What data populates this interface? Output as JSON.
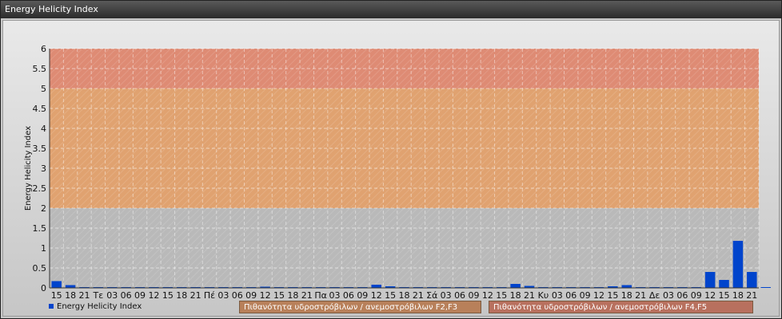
{
  "window": {
    "title": "Energy Helicity Index"
  },
  "chart_data": {
    "type": "bar",
    "title": "",
    "xlabel": "",
    "ylabel": "Energy Helicity Index",
    "ylim": [
      0,
      6
    ],
    "yticks": [
      "0",
      "0.5",
      "1",
      "1.5",
      "2",
      "2.5",
      "3",
      "3.5",
      "4",
      "4.5",
      "5",
      "5.5",
      "6"
    ],
    "grid": true,
    "legend_placement": "bottom",
    "categories": [
      "15",
      "18",
      "21",
      "Τε",
      "03",
      "06",
      "09",
      "12",
      "15",
      "18",
      "21",
      "Πέ",
      "03",
      "06",
      "09",
      "12",
      "15",
      "18",
      "21",
      "Πα",
      "03",
      "06",
      "09",
      "12",
      "15",
      "18",
      "21",
      "Σά",
      "03",
      "06",
      "09",
      "12",
      "15",
      "18",
      "21",
      "Κυ",
      "03",
      "06",
      "09",
      "12",
      "15",
      "18",
      "21",
      "Δε",
      "03",
      "06",
      "09",
      "12",
      "15",
      "18",
      "21"
    ],
    "series": [
      {
        "name": "Energy Helicity Index",
        "color": "#0044cc",
        "values": [
          0.17,
          0.07,
          0.01,
          0.01,
          0.01,
          0.01,
          0.01,
          0.02,
          0.01,
          0.01,
          0.01,
          0.01,
          0.01,
          0.01,
          0.02,
          0.03,
          0.02,
          0.02,
          0.01,
          0.01,
          0.01,
          0.01,
          0.02,
          0.08,
          0.04,
          0.01,
          0.01,
          0.01,
          0.01,
          0.01,
          0.01,
          0.02,
          0.02,
          0.1,
          0.05,
          0.01,
          0.01,
          0.01,
          0.01,
          0.01,
          0.04,
          0.07,
          0.01,
          0.01,
          0.01,
          0.01,
          0.01,
          0.4,
          0.2,
          1.18,
          0.4,
          0.01
        ]
      }
    ],
    "bands": [
      {
        "from": 2,
        "to": 5,
        "label": "Πιθανότητα υδροστρόβιλων / ανεμοστρόβιλων F2,F3",
        "color": "#e0a270"
      },
      {
        "from": 5,
        "to": 6,
        "label": "Πιθανότητα υδροστρόβιλων / ανεμοστρόβιλων F4,F5",
        "color": "#de8b74"
      }
    ]
  }
}
